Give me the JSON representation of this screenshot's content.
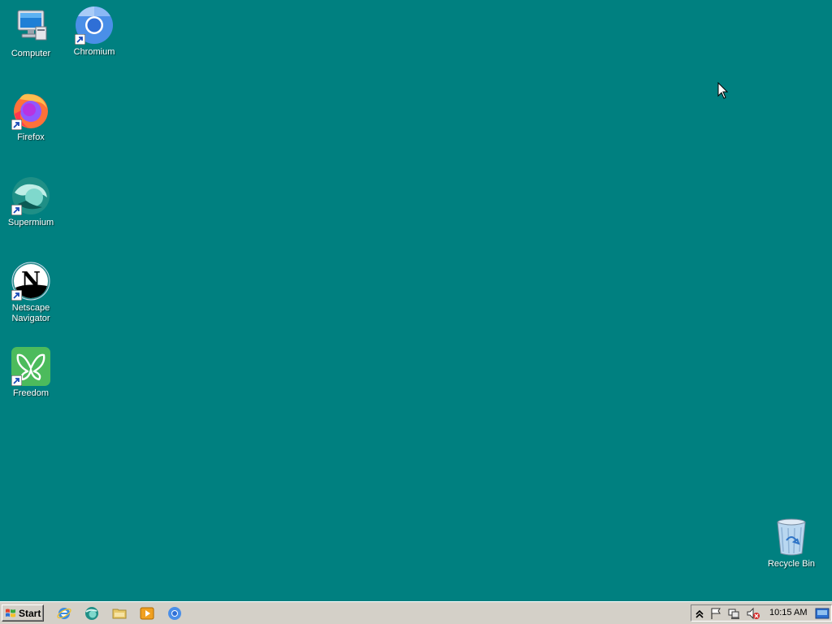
{
  "desktop": {
    "background_color": "#008080",
    "icons": [
      {
        "label": "Computer",
        "icon": "computer-icon"
      },
      {
        "label": "Chromium",
        "icon": "chromium-icon"
      },
      {
        "label": "Firefox",
        "icon": "firefox-icon"
      },
      {
        "label": "Supermium",
        "icon": "supermium-icon"
      },
      {
        "label": "Netscape Navigator",
        "icon": "netscape-navigator-icon"
      },
      {
        "label": "Freedom",
        "icon": "freedom-icon"
      },
      {
        "label": "Recycle Bin",
        "icon": "recycle-bin-icon"
      }
    ]
  },
  "taskbar": {
    "start_label": "Start",
    "quick_launch": [
      {
        "icon": "internet-explorer-icon"
      },
      {
        "icon": "supermium-icon"
      },
      {
        "icon": "folder-icon"
      },
      {
        "icon": "media-player-icon"
      },
      {
        "icon": "chromium-icon"
      }
    ],
    "tray": {
      "icons": [
        "show-hidden-icons-chevron",
        "action-center-flag-icon",
        "network-icon",
        "volume-muted-icon",
        "show-desktop-icon"
      ],
      "clock": "10:15 AM"
    }
  }
}
